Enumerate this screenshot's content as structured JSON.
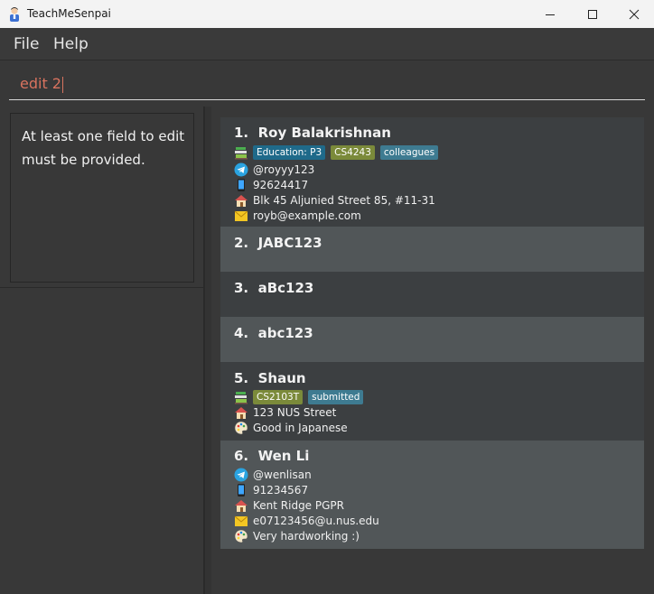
{
  "window": {
    "title": "TeachMeSenpai"
  },
  "menu": {
    "file": "File",
    "help": "Help"
  },
  "command": {
    "value": "edit 2"
  },
  "result": {
    "message": "At least one field to edit must be provided."
  },
  "students": [
    {
      "index": "1.",
      "name": "Roy Balakrishnan",
      "tags": [
        {
          "text": "Education: P3",
          "kind": "edu"
        },
        {
          "text": "CS4243",
          "kind": "mod"
        },
        {
          "text": "colleagues",
          "kind": "plain"
        }
      ],
      "telegram": "@royyy123",
      "phone": "92624417",
      "address": "Blk 45 Aljunied Street 85, #11-31",
      "email": "royb@example.com"
    },
    {
      "index": "2.",
      "name": "JABC123"
    },
    {
      "index": "3.",
      "name": "aBc123"
    },
    {
      "index": "4.",
      "name": "abc123"
    },
    {
      "index": "5.",
      "name": "Shaun",
      "tags": [
        {
          "text": "CS2103T",
          "kind": "mod"
        },
        {
          "text": "submitted",
          "kind": "plain"
        }
      ],
      "address": "123 NUS Street",
      "remark": "Good in Japanese"
    },
    {
      "index": "6.",
      "name": "Wen Li",
      "telegram": "@wenlisan",
      "phone": "91234567",
      "address": "Kent Ridge PGPR",
      "email": "e07123456@u.nus.edu",
      "remark": "Very hardworking :)"
    }
  ],
  "colors": {
    "card_dark": "#3c3f41",
    "card_light": "#515658",
    "command_text": "#d9735f",
    "tag_education": "#1f6a8a",
    "tag_module": "#7b8a3a",
    "tag_plain": "#3e7b91"
  },
  "icons": {
    "education": "books-icon",
    "telegram": "telegram-icon",
    "phone": "phone-icon",
    "address": "house-icon",
    "email": "email-icon",
    "remark": "palette-icon"
  }
}
